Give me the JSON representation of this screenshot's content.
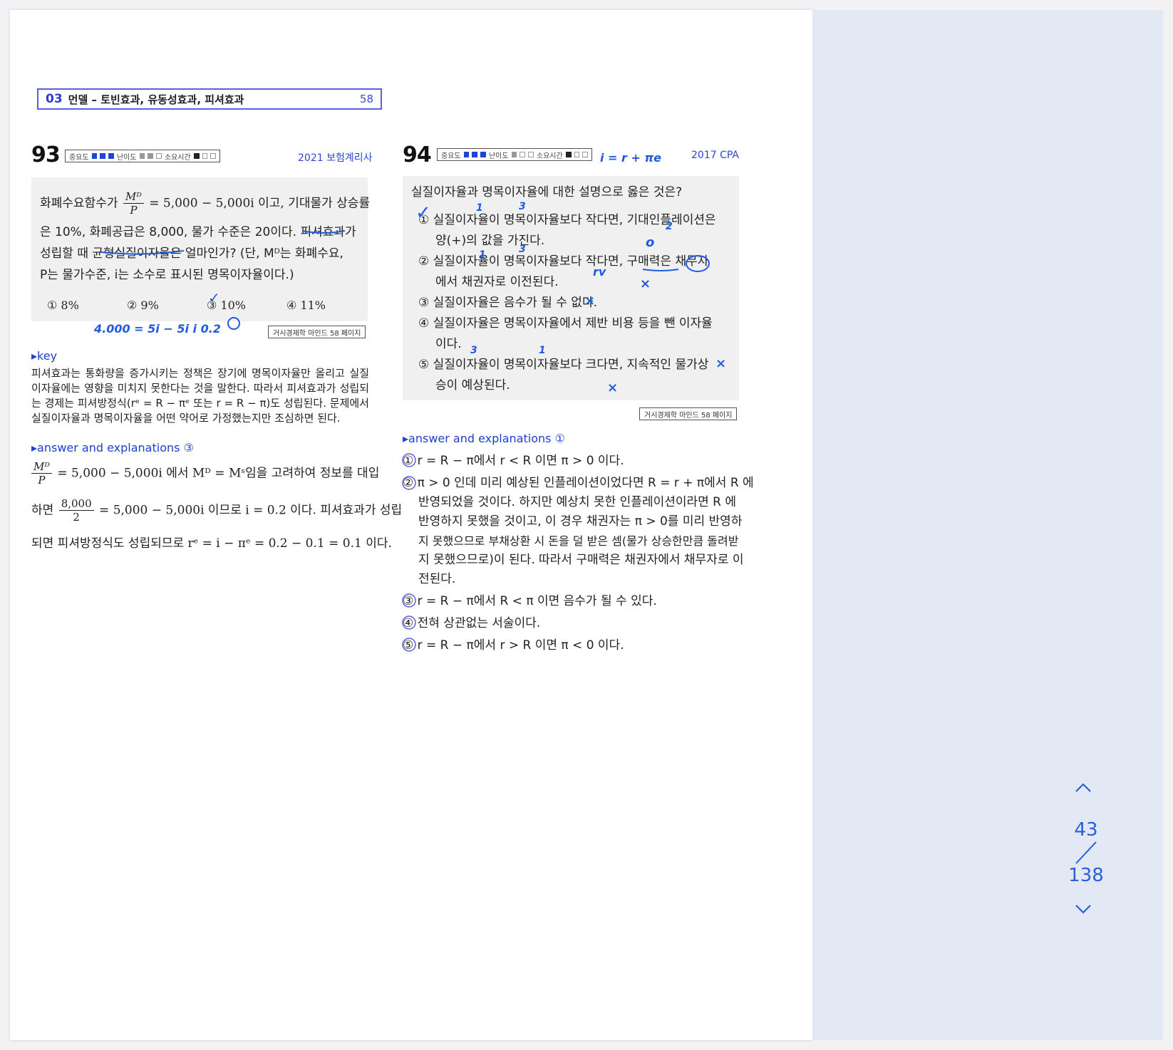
{
  "chapter": {
    "number": "03",
    "title": "먼델 – 토빈효과, 유동성효과, 피셔효과",
    "page": "58"
  },
  "q93": {
    "number": "93",
    "meta": {
      "importance": "중요도",
      "difficulty": "난이도",
      "time": "소요시간"
    },
    "source": "2021 보험계리사",
    "lines": [
      "은 10%, 화폐공급은 8,000, 물가 수준은 20이다. 피셔효과가",
      "성립할 때 균형실질이자율은 얼마인가? (단, Mᴰ는 화폐수요,",
      "P는 물가수준, i는 소수로 표시된 명목이자율이다.)"
    ],
    "line1_pre": "화폐수요함수가",
    "line1_post": "= 5,000 − 5,000i 이고, 기대물가 상승률",
    "frac_num": "Mᴰ",
    "frac_den": "P",
    "choices": [
      "① 8%",
      "② 9%",
      "③ 10%",
      "④ 11%"
    ],
    "ref": "거시경제학 마인드 58 페이지",
    "key_label": "▸key",
    "key_text": "피셔효과는 통화량을 증가시키는 정책은 장기에 명목이자율만 올리고 실질이자율에는 영향을 미치지 못한다는 것을 말한다. 따라서 피셔효과가 성립되는 경제는 피셔방정식(rᵉ = R − πᵉ 또는 r = R − π)도 성립된다. 문제에서 실질이자율과 명목이자율을 어떤 약어로 가정했는지만 조심하면 된다.",
    "ans_label": "▸answer and explanations ③",
    "ans_line1_post": "= 5,000 − 5,000i 에서  Mᴰ = Mˢ임을 고려하여 정보를 대입",
    "ans_line2_pre": "하면",
    "ans_frac_num": "8,000",
    "ans_frac_den": "2",
    "ans_line2_post": "= 5,000 − 5,000i 이므로  i = 0.2 이다. 피셔효과가 성립",
    "ans_line3": "되면 피셔방정식도 성립되므로 rᵉ = i − πᵉ = 0.2 − 0.1 = 0.1 이다."
  },
  "q94": {
    "number": "94",
    "meta": {
      "importance": "중요도",
      "difficulty": "난이도",
      "time": "소요시간"
    },
    "source": "2017 CPA",
    "question": "실질이자율과 명목이자율에 대한 설명으로 옳은 것은?",
    "options": [
      {
        "l1": "① 실질이자율이 명목이자율보다 작다면, 기대인플레이션은",
        "l2": "양(+)의 값을 가진다."
      },
      {
        "l1": "② 실질이자율이 명목이자율보다 작다면, 구매력은 채무자",
        "l2": "에서 채권자로 이전된다."
      },
      {
        "l1": "③ 실질이자율은 음수가 될 수 없다.",
        "l2": ""
      },
      {
        "l1": "④ 실질이자율은 명목이자율에서 제반 비용 등을 뺀 이자율",
        "l2": "이다."
      },
      {
        "l1": "⑤ 실질이자율이 명목이자율보다 크다면, 지속적인 물가상",
        "l2": "승이 예상된다."
      }
    ],
    "ref": "거시경제학 마인드 58 페이지",
    "ans_label": "▸answer and explanations ①",
    "answers": [
      "① r = R − π에서 r < R 이면 π > 0 이다.",
      "② π > 0 인데 미리 예상된 인플레이션이었다면 R = r + π에서 R 에",
      "반영되었을 것이다. 하지만 예상치 못한 인플레이션이라면 R 에",
      "반영하지 못했을 것이고, 이 경우 채권자는 π > 0를 미리 반영하",
      "지 못했으므로 부채상환 시 돈을 덜 받은 셈(물가 상승한만큼 돌려받",
      "지 못했으므로)이 된다. 따라서 구매력은 채권자에서 채무자로 이",
      "전된다.",
      "③ r = R − π에서 R < π 이면 음수가 될 수 있다.",
      "④ 전혀 상관없는 서술이다.",
      "⑤ r = R − π에서 r > R 이면 π < 0 이다."
    ]
  },
  "annotations": {
    "q93_under": "4.000 = 5i   − 5i  i 0.2",
    "q94_formula": "i = r + πe",
    "marks": [
      "✓",
      "✓",
      "1",
      "3",
      "2",
      "1",
      "3",
      "o",
      "rv",
      "×",
      "×",
      "3",
      "1",
      "×",
      "×",
      "×"
    ]
  },
  "pager": {
    "current": "43",
    "total": "138"
  },
  "colors": {
    "accent": "#1f44d8",
    "ink": "#1f5be0",
    "sidebar": "#e3e9f4"
  }
}
